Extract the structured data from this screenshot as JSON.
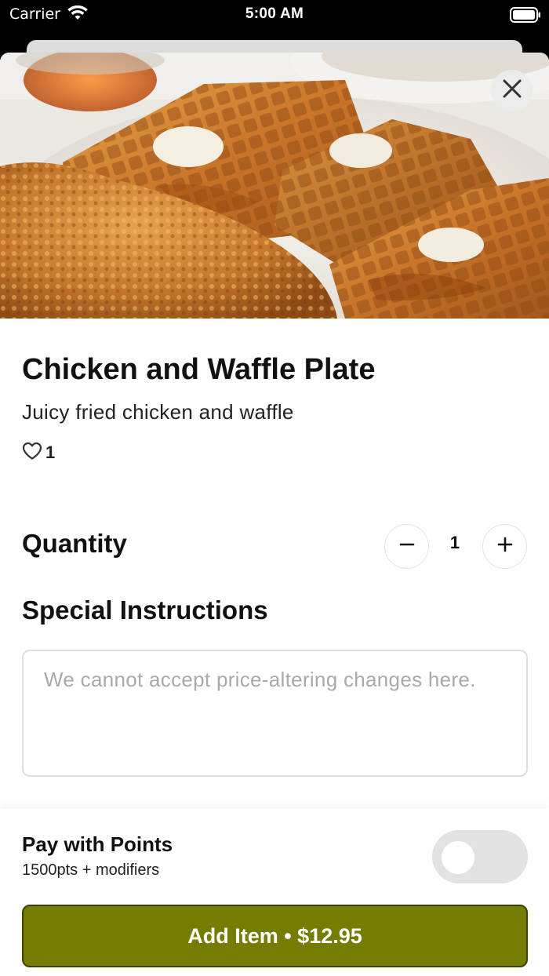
{
  "status_bar": {
    "carrier": "Carrier",
    "time": "5:00 AM"
  },
  "item": {
    "title": "Chicken and Waffle Plate",
    "description": "Juicy fried chicken and waffle",
    "likes": "1",
    "image_icon": "food-photo"
  },
  "quantity": {
    "label": "Quantity",
    "value": "1",
    "decrement_icon": "minus-icon",
    "increment_icon": "plus-icon"
  },
  "instructions": {
    "label": "Special Instructions",
    "value": "",
    "placeholder": "We cannot accept price-altering changes here."
  },
  "points": {
    "title": "Pay with Points",
    "subtitle": "1500pts + modifiers",
    "enabled": false
  },
  "add_button": {
    "label": "Add Item • $12.95"
  },
  "colors": {
    "accent": "#757d00",
    "accent_border": "#3d4200",
    "toggle_off": "#e2e2e2"
  }
}
